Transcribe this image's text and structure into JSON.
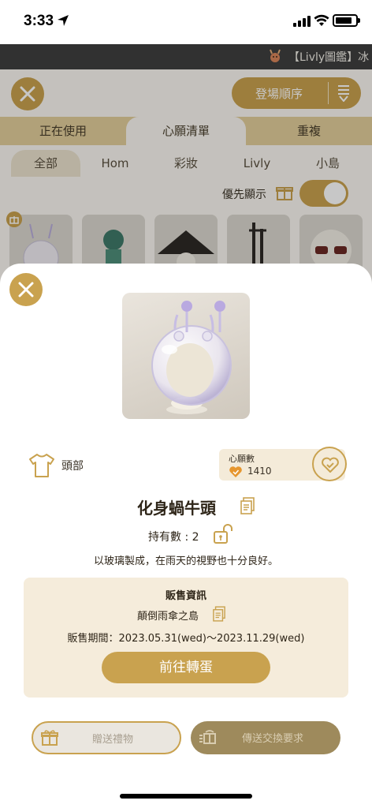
{
  "status_bar": {
    "time": "3:33"
  },
  "ticker": {
    "text": "【Livly圖鑑】冰"
  },
  "background": {
    "sort_label": "登場順序",
    "tabs": [
      {
        "label": "正在使用",
        "active": false
      },
      {
        "label": "心願清單",
        "active": true
      },
      {
        "label": "重複",
        "active": false
      }
    ],
    "subtabs": [
      {
        "label": "全部",
        "active": true
      },
      {
        "label": "Hom",
        "active": false
      },
      {
        "label": "彩妝",
        "active": false
      },
      {
        "label": "Livly",
        "active": false
      },
      {
        "label": "小島",
        "active": false
      }
    ],
    "priority_label": "優先顯示",
    "priority_toggle_on": true
  },
  "item": {
    "part_label": "頭部",
    "wish_title": "心願數",
    "wish_count": "1410",
    "name": "化身蝸牛頭",
    "owned": "持有數 : 2",
    "description": "以玻璃製成，在雨天的視野也十分良好。"
  },
  "sale": {
    "title": "販售資訊",
    "island": "顛倒雨傘之島",
    "period": "販售期間：2023.05.31(wed)～2023.11.29(wed)",
    "gacha_button": "前往轉蛋"
  },
  "actions": {
    "gift_button": "贈送禮物",
    "trade_button": "傳送交換要求"
  },
  "colors": {
    "accent": "#c9a24f",
    "sale_bg": "#f5ecdb",
    "ticker_bg": "#3f3f3f",
    "trade_bg": "#9e8a5c"
  }
}
